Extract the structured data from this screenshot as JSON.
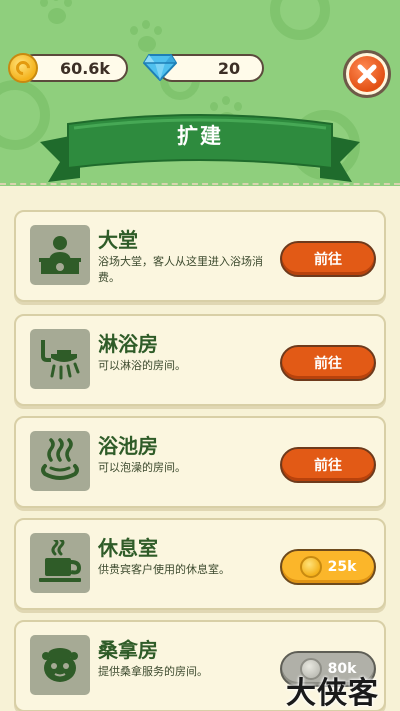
{
  "header": {
    "coins": "60.6k",
    "gems": "20",
    "title": "扩建"
  },
  "rooms": [
    {
      "name": "大堂",
      "desc": "浴场大堂，客人从这里进入浴场消费。",
      "action": "前往",
      "icon": "receptionist-desk-icon"
    },
    {
      "name": "淋浴房",
      "desc": "可以淋浴的房间。",
      "action": "前往",
      "icon": "shower-head-icon"
    },
    {
      "name": "浴池房",
      "desc": "可以泡澡的房间。",
      "action": "前往",
      "icon": "hot-spring-icon"
    },
    {
      "name": "休息室",
      "desc": "供贵宾客户使用的休息室。",
      "price": "25k",
      "icon": "coffee-cup-icon"
    },
    {
      "name": "桑拿房",
      "desc": "提供桑拿服务的房间。",
      "price": "80k",
      "icon": "sauna-face-icon"
    }
  ],
  "watermark": "大侠客",
  "colors": {
    "header_green": "#8fcf7d",
    "ribbon_green": "#2e8b3e",
    "go_button": "#e25a16",
    "price_button": "#fbb62a",
    "title_text": "#2f5c28"
  }
}
